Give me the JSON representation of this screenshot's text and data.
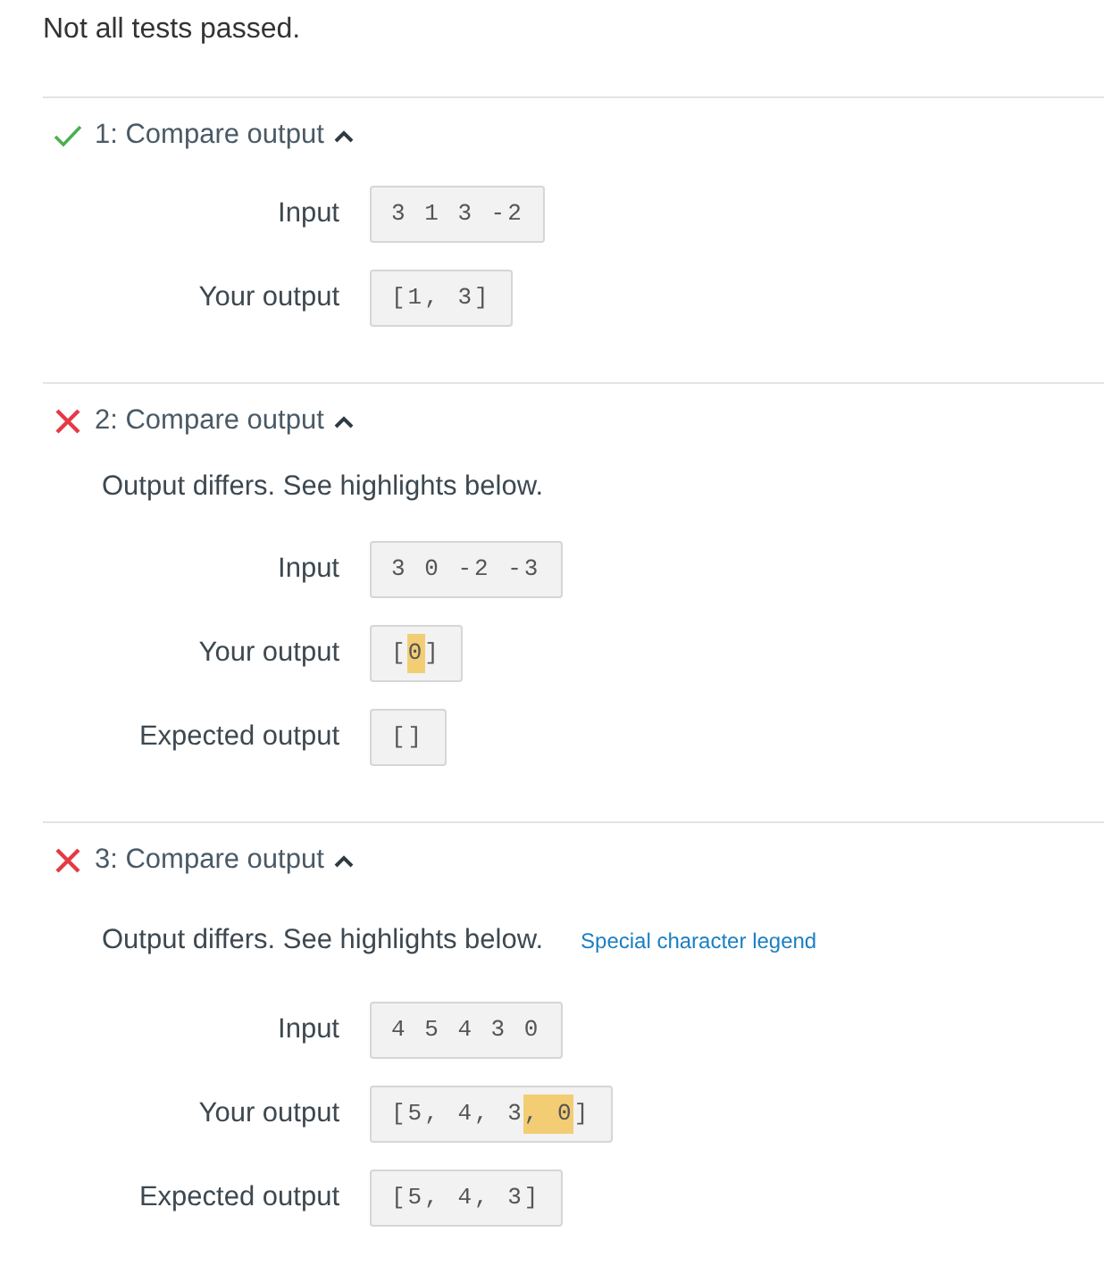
{
  "summary": "Not all tests passed.",
  "tests": [
    {
      "title": "1: Compare output",
      "passed": true,
      "expanded": true,
      "rows": [
        {
          "label": "Input",
          "segments": [
            {
              "text": "3 1 3 -2",
              "highlighted": false
            }
          ]
        },
        {
          "label": "Your output",
          "segments": [
            {
              "text": "[1, 3]",
              "highlighted": false
            }
          ]
        }
      ]
    },
    {
      "title": "2: Compare output",
      "passed": false,
      "expanded": true,
      "message": "Output differs. See highlights below.",
      "rows": [
        {
          "label": "Input",
          "segments": [
            {
              "text": "3 0 -2 -3",
              "highlighted": false
            }
          ]
        },
        {
          "label": "Your output",
          "segments": [
            {
              "text": "[",
              "highlighted": false
            },
            {
              "text": "0",
              "highlighted": true
            },
            {
              "text": "]",
              "highlighted": false
            }
          ]
        },
        {
          "label": "Expected output",
          "segments": [
            {
              "text": "[]",
              "highlighted": false
            }
          ]
        }
      ]
    },
    {
      "title": "3: Compare output",
      "passed": false,
      "expanded": true,
      "message": "Output differs. See highlights below.",
      "link": "Special character legend",
      "rows": [
        {
          "label": "Input",
          "segments": [
            {
              "text": "4 5 4 3 0",
              "highlighted": false
            }
          ]
        },
        {
          "label": "Your output",
          "segments": [
            {
              "text": "[5, 4, 3",
              "highlighted": false
            },
            {
              "text": ", 0",
              "highlighted": true
            },
            {
              "text": "]",
              "highlighted": false
            }
          ]
        },
        {
          "label": "Expected output",
          "segments": [
            {
              "text": "[5, 4, 3]",
              "highlighted": false
            }
          ]
        }
      ]
    }
  ]
}
